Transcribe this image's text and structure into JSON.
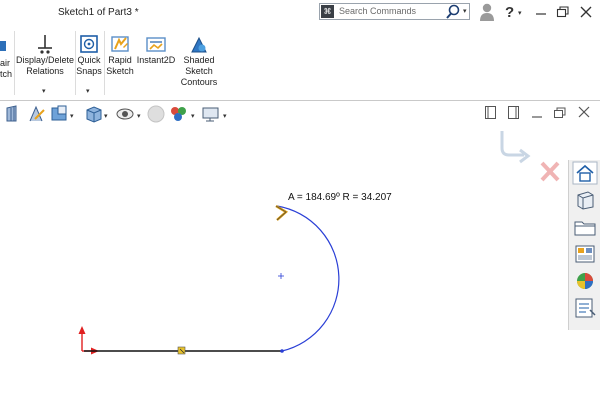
{
  "window": {
    "title": "Sketch1 of Part3 *",
    "search_placeholder": "Search Commands"
  },
  "ribbon": {
    "items": [
      {
        "label_1": "air",
        "label_2": "tch"
      },
      {
        "label_1": "Display/Delete",
        "label_2": "Relations"
      },
      {
        "label_1": "Quick",
        "label_2": "Snaps"
      },
      {
        "label_1": "Rapid",
        "label_2": "Sketch"
      },
      {
        "label_1": "Instant2D"
      },
      {
        "label_1": "Shaded",
        "label_2": "Sketch",
        "label_3": "Contours"
      }
    ]
  },
  "sketch": {
    "dimension_readout": "A = 184.69º R = 34.207"
  },
  "icons": [
    "search-commands-icon",
    "magnifier-icon",
    "user-icon",
    "help-icon",
    "minimize-icon",
    "restore-icon",
    "close-icon",
    "display-relations-icon",
    "quick-snaps-icon",
    "rapid-sketch-icon",
    "instant2d-icon",
    "shaded-contours-icon",
    "confirm-ok-icon",
    "cancel-x-icon",
    "home-icon",
    "parts-library-icon",
    "file-explorer-icon",
    "view-palette-icon",
    "appearances-icon",
    "custom-properties-icon"
  ],
  "colors": {
    "arc": "#2a3fd6",
    "line": "#111111",
    "origin": "#e02020",
    "cursor": "#d89a10"
  }
}
